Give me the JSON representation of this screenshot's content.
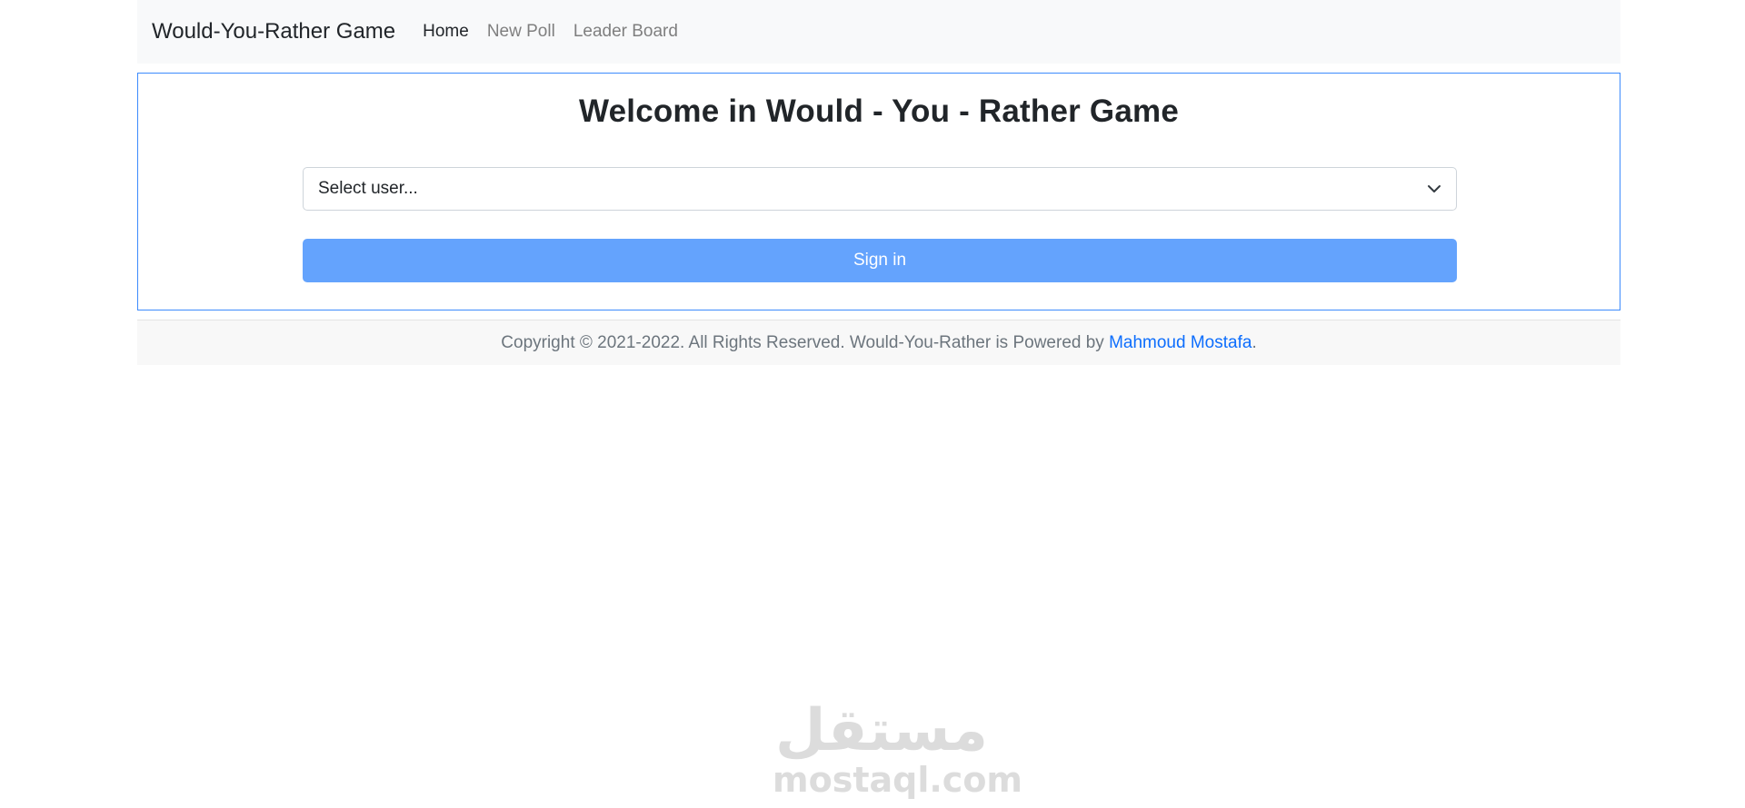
{
  "navbar": {
    "brand": "Would-You-Rather Game",
    "links": [
      {
        "label": "Home",
        "active": true
      },
      {
        "label": "New Poll",
        "active": false
      },
      {
        "label": "Leader Board",
        "active": false
      }
    ]
  },
  "login": {
    "title": "Welcome in Would - You - Rather Game",
    "select_placeholder": "Select user...",
    "sign_in_label": "Sign in"
  },
  "footer": {
    "text": "Copyright © 2021-2022. All Rights Reserved. Would-You-Rather is Powered by ",
    "author_link": "Mahmoud Mostafa",
    "suffix": "."
  },
  "watermark": {
    "arabic": "مستقل",
    "latin": "mostaql.com"
  },
  "icons": {
    "select_chevron": "chevron-down-icon"
  },
  "colors": {
    "accent_border": "#3d8bfd",
    "button_bg": "#64a3fd",
    "link": "#0d6efd",
    "navbar_bg": "#f8f9fa"
  }
}
